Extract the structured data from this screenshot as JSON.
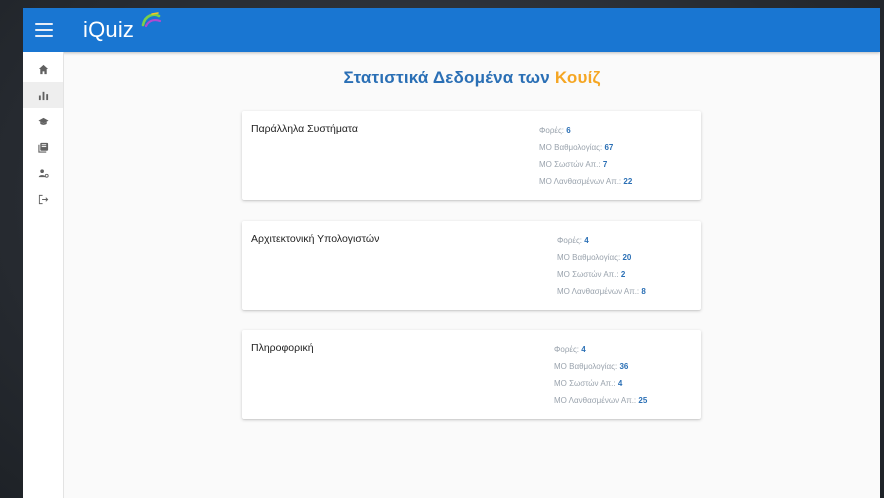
{
  "app": {
    "name": "iQuiz",
    "colors": {
      "primary": "#1976d2",
      "accent": "#f5a623",
      "value": "#2a6fb5"
    }
  },
  "sidebar": {
    "items": [
      {
        "icon": "home-icon",
        "active": false
      },
      {
        "icon": "bar-chart-icon",
        "active": true
      },
      {
        "icon": "graduation-cap-icon",
        "active": false
      },
      {
        "icon": "library-books-icon",
        "active": false
      },
      {
        "icon": "person-settings-icon",
        "active": false
      },
      {
        "icon": "logout-icon",
        "active": false
      }
    ]
  },
  "page": {
    "title_main": "Στατιστικά Δεδομένα των",
    "title_accent": "Κουίζ"
  },
  "labels": {
    "times": "Φορές:",
    "avg_grade": "ΜΟ Βαθμολογίας:",
    "avg_correct": "ΜΟ Σωστών Απ.:",
    "avg_wrong": "ΜΟ Λανθασμένων Απ.:"
  },
  "quizzes": [
    {
      "name": "Παράλληλα Συστήματα",
      "times": "6",
      "avg_grade": "67",
      "avg_correct": "7",
      "avg_wrong": "22"
    },
    {
      "name": "Αρχιτεκτονική Υπολογιστών",
      "times": "4",
      "avg_grade": "20",
      "avg_correct": "2",
      "avg_wrong": "8"
    },
    {
      "name": "Πληροφορική",
      "times": "4",
      "avg_grade": "36",
      "avg_correct": "4",
      "avg_wrong": "25"
    }
  ]
}
